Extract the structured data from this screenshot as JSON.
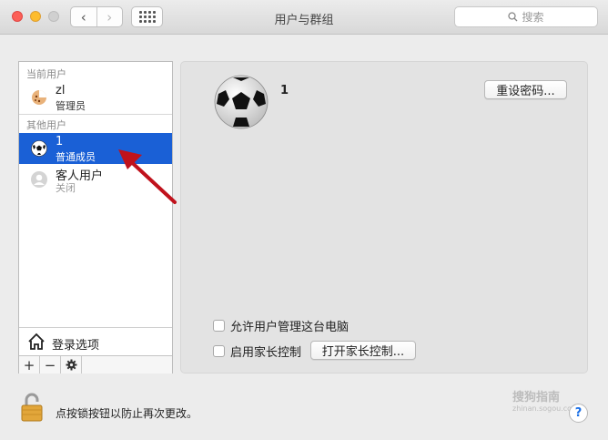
{
  "window": {
    "title": "用户与群组",
    "search_placeholder": "搜索"
  },
  "sidebar": {
    "current_section": "当前用户",
    "other_section": "其他用户",
    "users": [
      {
        "name": "zl",
        "role": "管理员"
      },
      {
        "name": "1",
        "role": "普通成员"
      },
      {
        "name": "客人用户",
        "role": "关闭"
      }
    ],
    "login_options": "登录选项",
    "toolbar": {
      "add": "+",
      "remove": "−"
    }
  },
  "detail": {
    "user_name": "1",
    "reset_password_button": "重设密码...",
    "allow_admin_label": "允许用户管理这台电脑",
    "parental_controls_label": "启用家长控制",
    "open_parental_button": "打开家长控制..."
  },
  "footer": {
    "lock_text": "点按锁按钮以防止再次更改。",
    "help": "?"
  },
  "watermark": {
    "line1": "搜狗指南",
    "line2": "zhinan.sogou.com"
  },
  "colors": {
    "selection": "#1a60d6",
    "arrow": "#c0121c"
  }
}
